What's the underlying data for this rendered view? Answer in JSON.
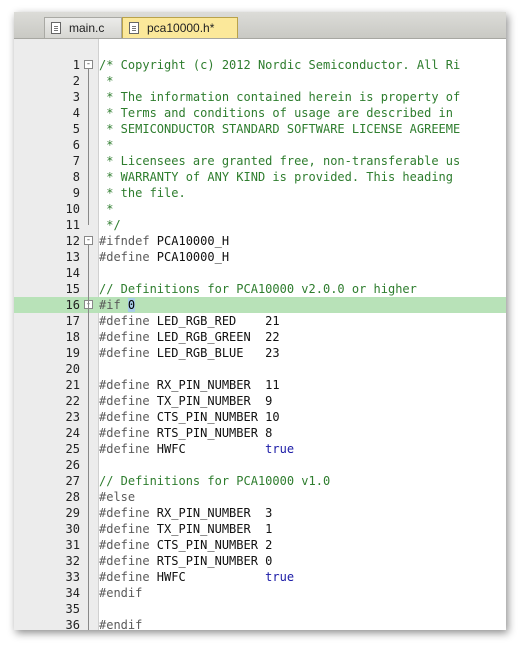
{
  "tabs": [
    {
      "label": "main.c",
      "active": false
    },
    {
      "label": "pca10000.h*",
      "active": true
    }
  ],
  "highlight_line": 16,
  "lines": [
    {
      "n": "1",
      "fold": "-",
      "tokens": [
        {
          "t": "/* Copyright (c) 2012 Nordic Semiconductor. All Ri",
          "c": "c"
        }
      ]
    },
    {
      "n": "2",
      "tokens": [
        {
          "t": " *",
          "c": "c"
        }
      ]
    },
    {
      "n": "3",
      "tokens": [
        {
          "t": " * The information contained herein is property of",
          "c": "c"
        }
      ]
    },
    {
      "n": "4",
      "tokens": [
        {
          "t": " * Terms and conditions of usage are described in",
          "c": "c"
        }
      ]
    },
    {
      "n": "5",
      "tokens": [
        {
          "t": " * SEMICONDUCTOR STANDARD SOFTWARE LICENSE AGREEME",
          "c": "c"
        }
      ]
    },
    {
      "n": "6",
      "tokens": [
        {
          "t": " *",
          "c": "c"
        }
      ]
    },
    {
      "n": "7",
      "tokens": [
        {
          "t": " * Licensees are granted free, non-transferable us",
          "c": "c"
        }
      ]
    },
    {
      "n": "8",
      "tokens": [
        {
          "t": " * WARRANTY of ANY KIND is provided. This heading",
          "c": "c"
        }
      ]
    },
    {
      "n": "9",
      "tokens": [
        {
          "t": " * the file.",
          "c": "c"
        }
      ]
    },
    {
      "n": "10",
      "tokens": [
        {
          "t": " *",
          "c": "c"
        }
      ]
    },
    {
      "n": "11",
      "tokens": [
        {
          "t": " */",
          "c": "c"
        }
      ]
    },
    {
      "n": "12",
      "fold": "-",
      "tokens": [
        {
          "t": "#ifndef ",
          "c": "pp"
        },
        {
          "t": "PCA10000_H",
          "c": "id"
        }
      ]
    },
    {
      "n": "13",
      "tokens": [
        {
          "t": "#define ",
          "c": "pp"
        },
        {
          "t": "PCA10000_H",
          "c": "id"
        }
      ]
    },
    {
      "n": "14",
      "tokens": []
    },
    {
      "n": "15",
      "tokens": [
        {
          "t": "// Definitions for PCA10000 v2.0.0 or higher",
          "c": "c"
        }
      ]
    },
    {
      "n": "16",
      "fold": "-",
      "tokens": [
        {
          "t": "#if ",
          "c": "pp"
        },
        {
          "t": "0",
          "c": "sel"
        }
      ]
    },
    {
      "n": "17",
      "tokens": [
        {
          "t": "#define ",
          "c": "pp"
        },
        {
          "t": "LED_RGB_RED    ",
          "c": "id"
        },
        {
          "t": "21",
          "c": "num"
        }
      ]
    },
    {
      "n": "18",
      "tokens": [
        {
          "t": "#define ",
          "c": "pp"
        },
        {
          "t": "LED_RGB_GREEN  ",
          "c": "id"
        },
        {
          "t": "22",
          "c": "num"
        }
      ]
    },
    {
      "n": "19",
      "tokens": [
        {
          "t": "#define ",
          "c": "pp"
        },
        {
          "t": "LED_RGB_BLUE   ",
          "c": "id"
        },
        {
          "t": "23",
          "c": "num"
        }
      ]
    },
    {
      "n": "20",
      "tokens": []
    },
    {
      "n": "21",
      "tokens": [
        {
          "t": "#define ",
          "c": "pp"
        },
        {
          "t": "RX_PIN_NUMBER  ",
          "c": "id"
        },
        {
          "t": "11",
          "c": "num"
        }
      ]
    },
    {
      "n": "22",
      "tokens": [
        {
          "t": "#define ",
          "c": "pp"
        },
        {
          "t": "TX_PIN_NUMBER  ",
          "c": "id"
        },
        {
          "t": "9",
          "c": "num"
        }
      ]
    },
    {
      "n": "23",
      "tokens": [
        {
          "t": "#define ",
          "c": "pp"
        },
        {
          "t": "CTS_PIN_NUMBER ",
          "c": "id"
        },
        {
          "t": "10",
          "c": "num"
        }
      ]
    },
    {
      "n": "24",
      "tokens": [
        {
          "t": "#define ",
          "c": "pp"
        },
        {
          "t": "RTS_PIN_NUMBER ",
          "c": "id"
        },
        {
          "t": "8",
          "c": "num"
        }
      ]
    },
    {
      "n": "25",
      "tokens": [
        {
          "t": "#define ",
          "c": "pp"
        },
        {
          "t": "HWFC           ",
          "c": "id"
        },
        {
          "t": "true",
          "c": "kw"
        }
      ]
    },
    {
      "n": "26",
      "tokens": []
    },
    {
      "n": "27",
      "tokens": [
        {
          "t": "// Definitions for PCA10000 v1.0",
          "c": "c"
        }
      ]
    },
    {
      "n": "28",
      "tokens": [
        {
          "t": "#else",
          "c": "pp"
        }
      ]
    },
    {
      "n": "29",
      "tokens": [
        {
          "t": "#define ",
          "c": "pp"
        },
        {
          "t": "RX_PIN_NUMBER  ",
          "c": "id"
        },
        {
          "t": "3",
          "c": "num"
        }
      ]
    },
    {
      "n": "30",
      "tokens": [
        {
          "t": "#define ",
          "c": "pp"
        },
        {
          "t": "TX_PIN_NUMBER  ",
          "c": "id"
        },
        {
          "t": "1",
          "c": "num"
        }
      ]
    },
    {
      "n": "31",
      "tokens": [
        {
          "t": "#define ",
          "c": "pp"
        },
        {
          "t": "CTS_PIN_NUMBER ",
          "c": "id"
        },
        {
          "t": "2",
          "c": "num"
        }
      ]
    },
    {
      "n": "32",
      "tokens": [
        {
          "t": "#define ",
          "c": "pp"
        },
        {
          "t": "RTS_PIN_NUMBER ",
          "c": "id"
        },
        {
          "t": "0",
          "c": "num"
        }
      ]
    },
    {
      "n": "33",
      "tokens": [
        {
          "t": "#define ",
          "c": "pp"
        },
        {
          "t": "HWFC           ",
          "c": "id"
        },
        {
          "t": "true",
          "c": "kw"
        }
      ]
    },
    {
      "n": "34",
      "tokens": [
        {
          "t": "#endif",
          "c": "pp"
        }
      ]
    },
    {
      "n": "35",
      "tokens": []
    },
    {
      "n": "36",
      "tokens": [
        {
          "t": "#endif",
          "c": "pp"
        }
      ]
    }
  ]
}
